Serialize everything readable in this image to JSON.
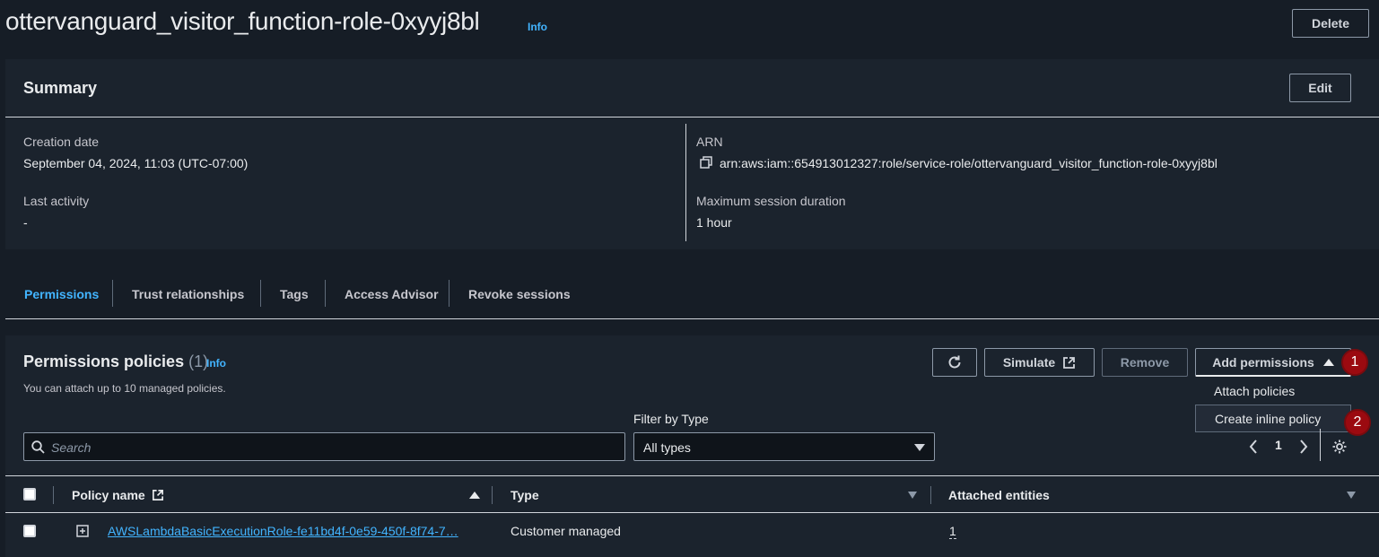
{
  "page": {
    "title": "ottervanguard_visitor_function-role-0xyyj8bl",
    "info": "Info",
    "delete_label": "Delete"
  },
  "summary": {
    "title": "Summary",
    "edit_label": "Edit",
    "creation_date_label": "Creation date",
    "creation_date_value": "September 04, 2024, 11:03 (UTC-07:00)",
    "last_activity_label": "Last activity",
    "last_activity_value": "-",
    "arn_label": "ARN",
    "arn_value": "arn:aws:iam::654913012327:role/service-role/ottervanguard_visitor_function-role-0xyyj8bl",
    "max_session_label": "Maximum session duration",
    "max_session_value": "1 hour"
  },
  "tabs": [
    {
      "label": "Permissions",
      "active": true
    },
    {
      "label": "Trust relationships"
    },
    {
      "label": "Tags"
    },
    {
      "label": "Access Advisor"
    },
    {
      "label": "Revoke sessions"
    }
  ],
  "policies": {
    "title": "Permissions policies",
    "count": "(1)",
    "info": "Info",
    "subtitle": "You can attach up to 10 managed policies.",
    "simulate_label": "Simulate",
    "remove_label": "Remove",
    "add_permissions_label": "Add permissions",
    "dropdown": [
      "Attach policies",
      "Create inline policy"
    ],
    "badges": [
      "1",
      "2"
    ],
    "filter_label": "Filter by Type",
    "search_placeholder": "Search",
    "type_selected": "All types",
    "page_number": "1",
    "columns": [
      "Policy name",
      "Type",
      "Attached entities"
    ],
    "rows": [
      {
        "name": "AWSLambdaBasicExecutionRole-fe11bd4f-0e59-450f-8f74-7…",
        "type": "Customer managed",
        "attached": "1"
      }
    ]
  },
  "colors": {
    "background": "#161d26",
    "panel": "#1b232d",
    "accent": "#42b4ff",
    "badge": "#9b0a10"
  }
}
